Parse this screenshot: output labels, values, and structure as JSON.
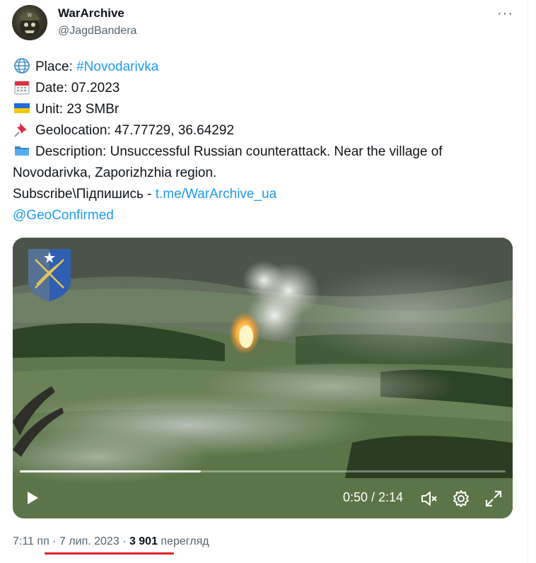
{
  "author": {
    "name": "WarArchive",
    "handle": "@JagdBandera"
  },
  "more_label": "···",
  "tweet": {
    "lines": [
      {
        "icon": "globe-icon",
        "label": "Place: ",
        "link": "#Novodarivka"
      },
      {
        "icon": "calendar-icon",
        "label": "Date: 07.2023"
      },
      {
        "icon": "ukraine-flag-icon",
        "label": "Unit: 23 SMBr"
      },
      {
        "icon": "pushpin-icon",
        "label": "Geolocation: 47.77729, 36.64292"
      },
      {
        "icon": "folder-icon",
        "label": "Description: Unsuccessful Russian counterattack. Near the village of Novodarivka, Zaporizhzhia region."
      }
    ],
    "subscribe_label": "Subscribe\\Підпишись - ",
    "subscribe_link": "t.me/WarArchive_ua",
    "mention": "@GeoConfirmed"
  },
  "video": {
    "current_time": "0:50",
    "duration": "2:14",
    "time_display": "0:50 / 2:14",
    "progress_fraction": 0.373,
    "controls": [
      "play-icon",
      "mute-icon",
      "settings-gear-icon",
      "fullscreen-icon"
    ]
  },
  "meta": {
    "time": "7:11 пп",
    "separator": " · ",
    "date": "7 лип. 2023",
    "views_count": "3 901",
    "views_label": " перегляд"
  },
  "colors": {
    "link": "#1d9bf0",
    "secondary_text": "#536471",
    "underline": "#e0202a"
  }
}
